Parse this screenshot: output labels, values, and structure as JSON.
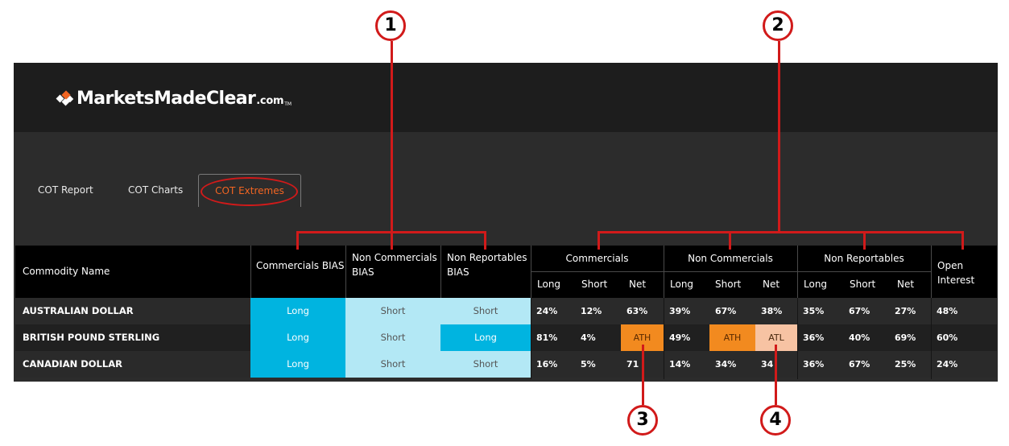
{
  "brand": {
    "name": "MarketsMadeClear",
    "suffix": ".com",
    "tm": "TM"
  },
  "tabs": [
    {
      "label": "COT Report",
      "active": false
    },
    {
      "label": "COT Charts",
      "active": false
    },
    {
      "label": "COT Extremes",
      "active": true
    }
  ],
  "table": {
    "headers": {
      "commodity": "Commodity Name",
      "comm_bias": "Commercials BIAS",
      "noncomm_bias": "Non Commercials BIAS",
      "nonrep_bias": "Non Reportables BIAS",
      "groups": [
        "Commercials",
        "Non Commercials",
        "Non Reportables"
      ],
      "sub": [
        "Long",
        "Short",
        "Net"
      ],
      "open_interest": "Open Interest"
    },
    "rows": [
      {
        "name": "AUSTRALIAN DOLLAR",
        "bias": [
          "Long",
          "Short",
          "Short"
        ],
        "comm": [
          "24%",
          "12%",
          "63%"
        ],
        "noncomm": [
          "39%",
          "67%",
          "38%"
        ],
        "nonrep": [
          "35%",
          "67%",
          "27%"
        ],
        "oi": "48%"
      },
      {
        "name": "BRITISH POUND STERLING",
        "bias": [
          "Long",
          "Short",
          "Long"
        ],
        "comm": [
          "81%",
          "4%",
          "ATH"
        ],
        "noncomm": [
          "49%",
          "ATH",
          "ATL"
        ],
        "nonrep": [
          "36%",
          "40%",
          "69%"
        ],
        "oi": "60%"
      },
      {
        "name": "CANADIAN DOLLAR",
        "bias": [
          "Long",
          "Short",
          "Short"
        ],
        "comm": [
          "16%",
          "5%",
          "71"
        ],
        "noncomm": [
          "14%",
          "34%",
          "34"
        ],
        "nonrep": [
          "36%",
          "67%",
          "25%"
        ],
        "oi": "24%"
      }
    ]
  },
  "annotations": [
    "1",
    "2",
    "3",
    "4"
  ],
  "colors": {
    "accent": "#f26522",
    "long": "#00b4e0",
    "short": "#b3e8f5",
    "ath": "#f28a1f",
    "atl": "#f7c3a3",
    "annotation": "#d11a1a"
  }
}
